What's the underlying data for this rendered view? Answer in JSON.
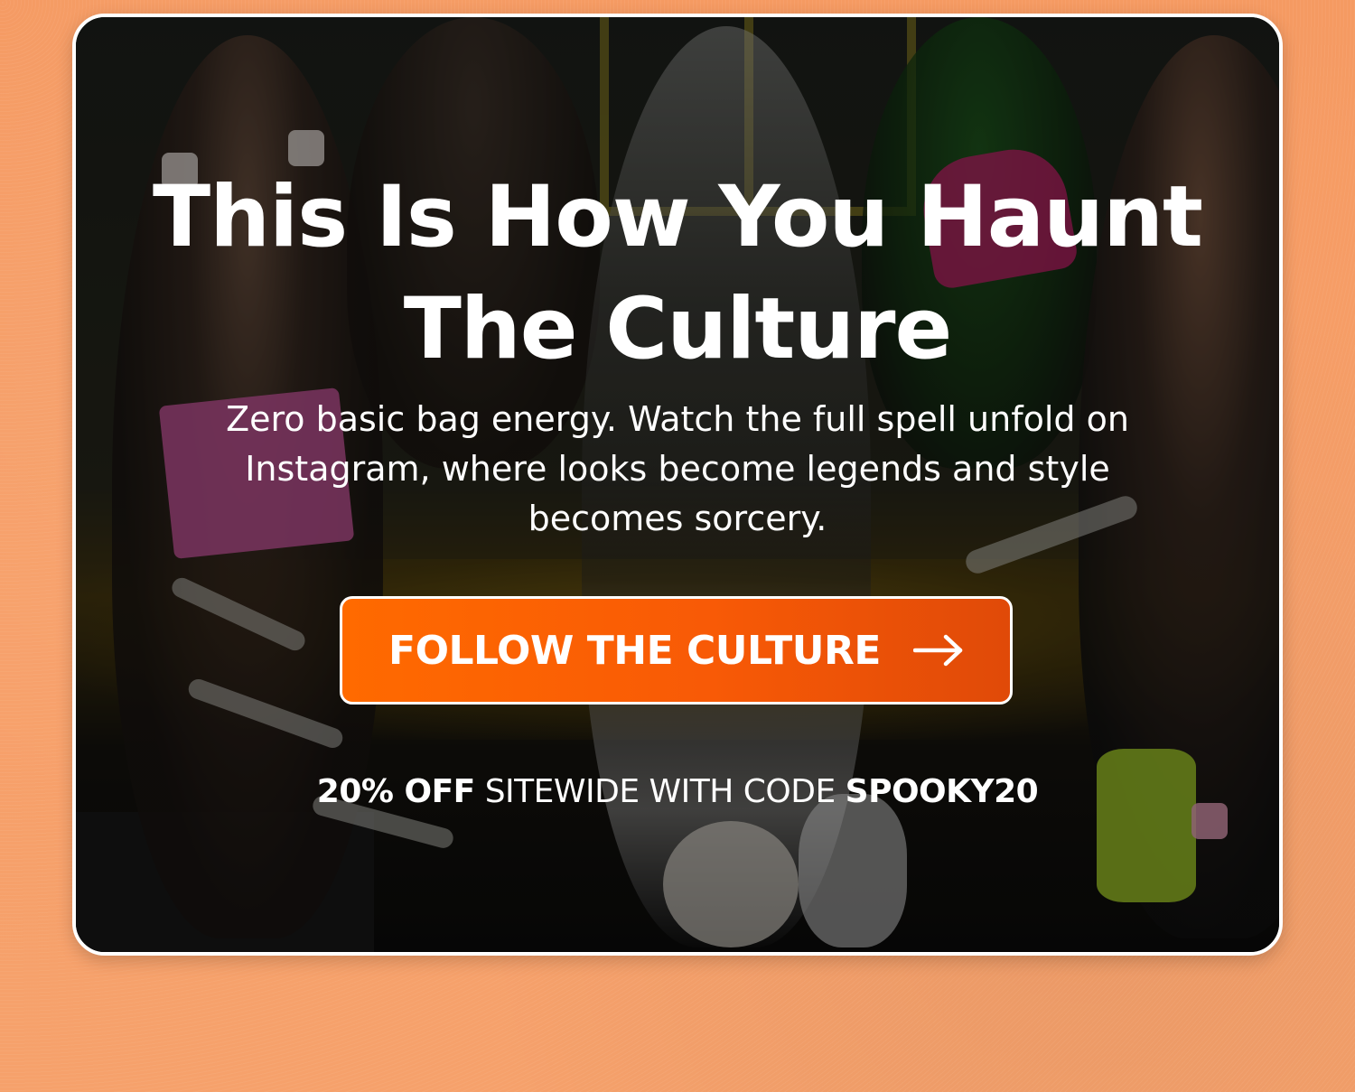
{
  "headline": {
    "line1": "This Is How You Haunt",
    "line2": "The Culture"
  },
  "subtext": "Zero basic bag energy. Watch the full spell unfold on Instagram, where looks become legends and style becomes sorcery.",
  "cta": {
    "label": "FOLLOW THE CULTURE",
    "icon": "arrow-right-icon"
  },
  "promo": {
    "discount": "20% OFF",
    "middle": " SITEWIDE WITH CODE ",
    "code": "SPOOKY20"
  },
  "colors": {
    "page_background": "#f7a06a",
    "cta_background": "#ff6a00",
    "text": "#ffffff",
    "card_border": "#ffffff"
  }
}
